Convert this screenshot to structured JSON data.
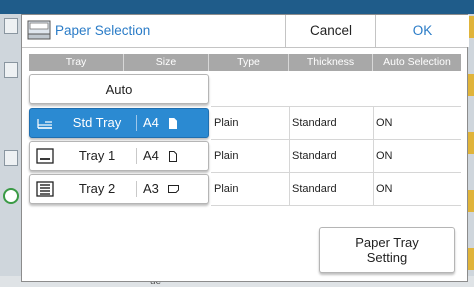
{
  "background": {
    "bottom_text": "ue"
  },
  "dialog": {
    "title": "Paper Selection",
    "cancel_label": "Cancel",
    "ok_label": "OK"
  },
  "table": {
    "headers": [
      "Tray",
      "Size",
      "Type",
      "Thickness",
      "Auto Selection"
    ],
    "auto_label": "Auto",
    "rows": [
      {
        "tray": "Std Tray",
        "size": "A4",
        "size_icon": "portrait-paper-icon",
        "tray_icon": "std-tray-icon",
        "type": "Plain",
        "thickness": "Standard",
        "auto_selection": "ON",
        "selected": true
      },
      {
        "tray": "Tray 1",
        "size": "A4",
        "size_icon": "portrait-paper-icon",
        "tray_icon": "tray1-icon",
        "type": "Plain",
        "thickness": "Standard",
        "auto_selection": "ON",
        "selected": false
      },
      {
        "tray": "Tray 2",
        "size": "A3",
        "size_icon": "landscape-paper-icon",
        "tray_icon": "tray2-icon",
        "type": "Plain",
        "thickness": "Standard",
        "auto_selection": "ON",
        "selected": false
      }
    ]
  },
  "footer": {
    "paper_tray_setting_label": "Paper Tray\nSetting"
  },
  "colors": {
    "accent": "#2b7cc7",
    "selected_row": "#2b8ad2",
    "header_bg": "#a8a8a8"
  }
}
